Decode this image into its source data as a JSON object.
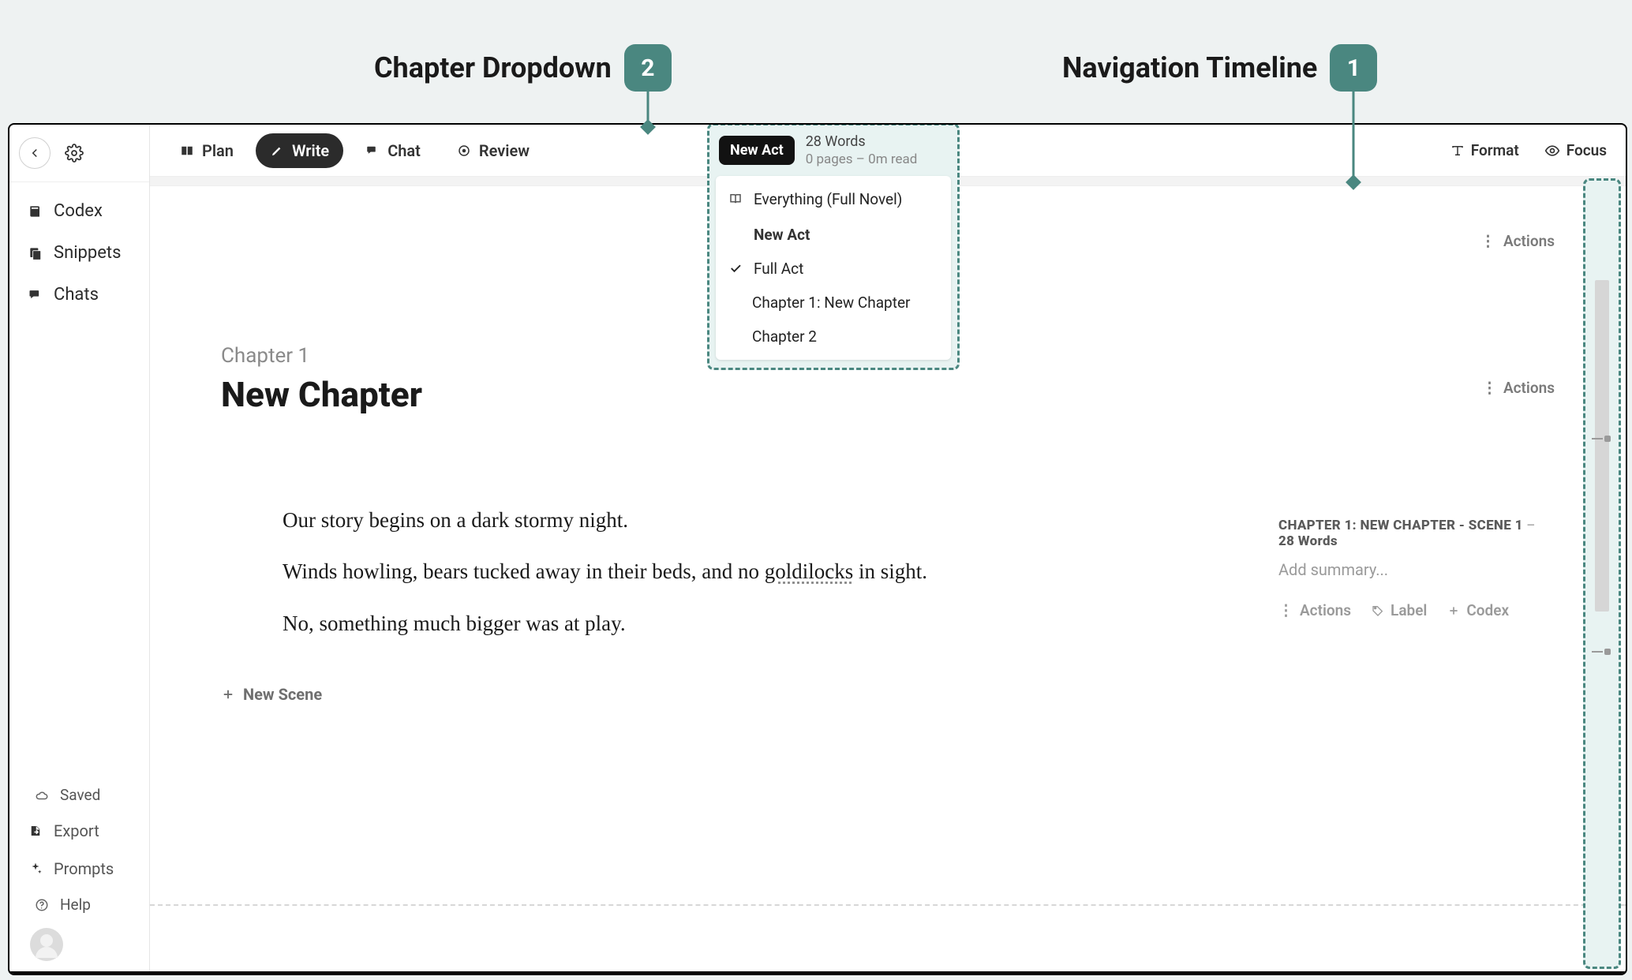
{
  "annotations": {
    "chapter_dropdown": "Chapter Dropdown",
    "chapter_dropdown_num": "2",
    "navigation_timeline": "Navigation Timeline",
    "navigation_timeline_num": "1"
  },
  "rail": {
    "codex": "Codex",
    "snippets": "Snippets",
    "chats": "Chats",
    "saved": "Saved",
    "export": "Export",
    "prompts": "Prompts",
    "help": "Help"
  },
  "toolbar": {
    "plan": "Plan",
    "write": "Write",
    "chat": "Chat",
    "review": "Review",
    "format": "Format",
    "focus": "Focus"
  },
  "dropdown": {
    "pill": "New Act",
    "words": "28 Words",
    "substats": "0 pages  –  0m read",
    "everything": "Everything (Full Novel)",
    "act_header": "New Act",
    "full_act": "Full Act",
    "ch1": "Chapter 1: New Chapter",
    "ch2": "Chapter 2"
  },
  "act": {
    "actions": "Actions"
  },
  "chapter": {
    "kicker": "Chapter 1",
    "title": "New Chapter",
    "actions": "Actions"
  },
  "prose": {
    "p1": "Our story begins on a dark stormy night.",
    "p2a": "Winds howling, bears tucked away in their beds, and no ",
    "p2_spell": "goldilocks",
    "p2b": " in sight.",
    "p3": "No, something much bigger was at play."
  },
  "scene": {
    "title_a": "CHAPTER 1: NEW CHAPTER - SCENE 1",
    "title_sep": "–",
    "title_b": "28 Words",
    "summary_placeholder": "Add summary...",
    "actions": "Actions",
    "label": "Label",
    "codex": "Codex"
  },
  "new_scene": "New Scene"
}
